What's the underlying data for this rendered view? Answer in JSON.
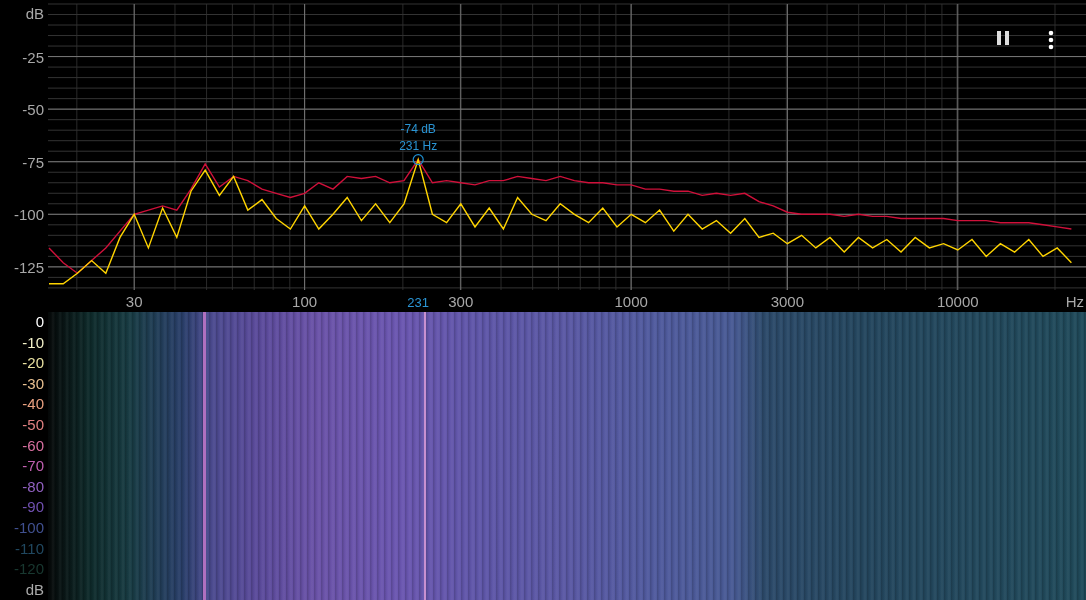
{
  "chart": {
    "chart_data": {
      "type": "line",
      "xlabel": "Hz",
      "ylabel": "dB",
      "categories": [
        null,
        null,
        null,
        null,
        null,
        null,
        "30",
        null,
        null,
        null,
        null,
        null,
        null,
        null,
        null,
        null,
        null,
        null,
        "100",
        null,
        null,
        null,
        null,
        null,
        null,
        null,
        "231",
        null,
        null,
        "300",
        null,
        null,
        null,
        null,
        null,
        null,
        null,
        null,
        null,
        null,
        null,
        "1000",
        null,
        null,
        null,
        null,
        null,
        null,
        null,
        null,
        null,
        null,
        "3000",
        null,
        null,
        null,
        null,
        null,
        null,
        null,
        null,
        null,
        null,
        null,
        "10000",
        null,
        null,
        null,
        null,
        null,
        null,
        null,
        null
      ],
      "series": [
        {
          "color": "#d0103a",
          "values": [
            -116,
            -123,
            -128,
            -122,
            -116,
            -108,
            -100,
            -98,
            -96,
            -98,
            -88,
            -76,
            -87,
            -82,
            -84,
            -88,
            -90,
            -92,
            -90,
            -85,
            -88,
            -82,
            -83,
            -82,
            -85,
            -84,
            -74,
            -85,
            -84,
            -85,
            -86,
            -84,
            -84,
            -82,
            -83,
            -84,
            -82,
            -84,
            -85,
            -85,
            -86,
            -86,
            -88,
            -88,
            -89,
            -89,
            -91,
            -90,
            -91,
            -90,
            -94,
            -96,
            -99,
            -100,
            -100,
            -100,
            -101,
            -100,
            -101,
            -101,
            -102,
            -102,
            -102,
            -102,
            -103,
            -103,
            -103,
            -104,
            -104,
            -104,
            -105,
            -106,
            -107
          ]
        },
        {
          "color": "#ffd400",
          "values": [
            -133,
            -133,
            -128,
            -122,
            -128,
            -111,
            -100,
            -116,
            -97,
            -111,
            -89,
            -79,
            -91,
            -82,
            -98,
            -93,
            -102,
            -107,
            -96,
            -107,
            -100,
            -92,
            -103,
            -95,
            -104,
            -95,
            -74,
            -100,
            -104,
            -95,
            -106,
            -97,
            -107,
            -92,
            -100,
            -103,
            -95,
            -100,
            -104,
            -97,
            -106,
            -100,
            -104,
            -98,
            -108,
            -100,
            -107,
            -103,
            -109,
            -102,
            -111,
            -109,
            -114,
            -110,
            -116,
            -111,
            -118,
            -111,
            -116,
            -112,
            -118,
            -111,
            -116,
            -114,
            -117,
            -112,
            -120,
            -114,
            -118,
            -112,
            -120,
            -116,
            -123
          ]
        }
      ],
      "ylim": [
        -136,
        0
      ],
      "grid": true,
      "yticks": [
        -25,
        -50,
        -75,
        -100,
        -125
      ],
      "annotations": [
        {
          "x": "231",
          "y": -74,
          "text": "-74 dB"
        },
        {
          "x": "231",
          "y": -74,
          "text": "231 Hz"
        }
      ]
    }
  },
  "spectrogram": {
    "scale": [
      {
        "label": "0",
        "color": "#ffffff"
      },
      {
        "label": "-10",
        "color": "#f2f0c8"
      },
      {
        "label": "-20",
        "color": "#e8e0a0"
      },
      {
        "label": "-30",
        "color": "#e8c090"
      },
      {
        "label": "-40",
        "color": "#e8a080"
      },
      {
        "label": "-50",
        "color": "#e08080"
      },
      {
        "label": "-60",
        "color": "#d870a0"
      },
      {
        "label": "-70",
        "color": "#c060b0"
      },
      {
        "label": "-80",
        "color": "#9060c0"
      },
      {
        "label": "-90",
        "color": "#7050b0"
      },
      {
        "label": "-100",
        "color": "#405090"
      },
      {
        "label": "-110",
        "color": "#204860"
      },
      {
        "label": "-120",
        "color": "#183830"
      }
    ],
    "unit": "dB"
  }
}
